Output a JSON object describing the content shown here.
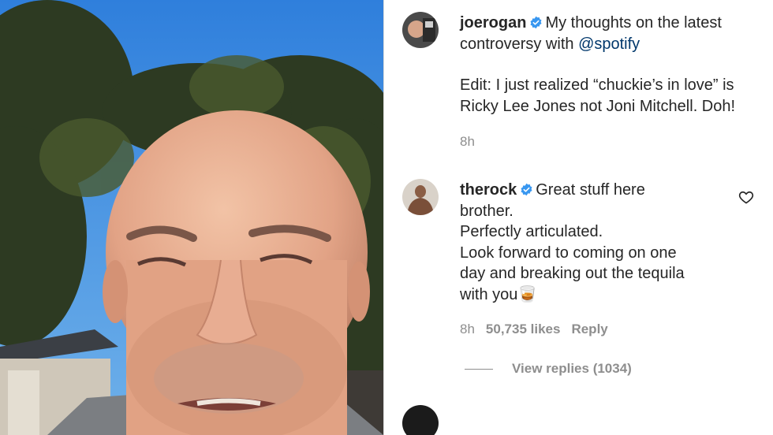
{
  "post": {
    "username": "joerogan",
    "caption_before": "My thoughts on the latest controversy with ",
    "mention": "@spotify",
    "edit_line": "Edit: I just realized “chuckie’s in love” is Ricky Lee Jones not Joni Mitchell. Doh!",
    "time": "8h"
  },
  "comment": {
    "username": "therock",
    "line1": "Great stuff here",
    "line2": "brother.",
    "line3": "Perfectly articulated.",
    "line4": "Look forward to coming on one",
    "line5": "day and breaking out the tequila",
    "line6": "with you🥃",
    "time": "8h",
    "likes": "50,735 likes",
    "reply_label": "Reply",
    "view_replies": "View replies (1034)"
  },
  "next_comment": {
    "username_partial": "..."
  },
  "colors": {
    "verified": "#3897f0",
    "mention": "#00376b",
    "meta": "#8e8e8e",
    "text": "#262626",
    "sky": "#3f8be0"
  },
  "icons": {
    "verified": "verified-badge-icon",
    "like": "heart-icon"
  }
}
